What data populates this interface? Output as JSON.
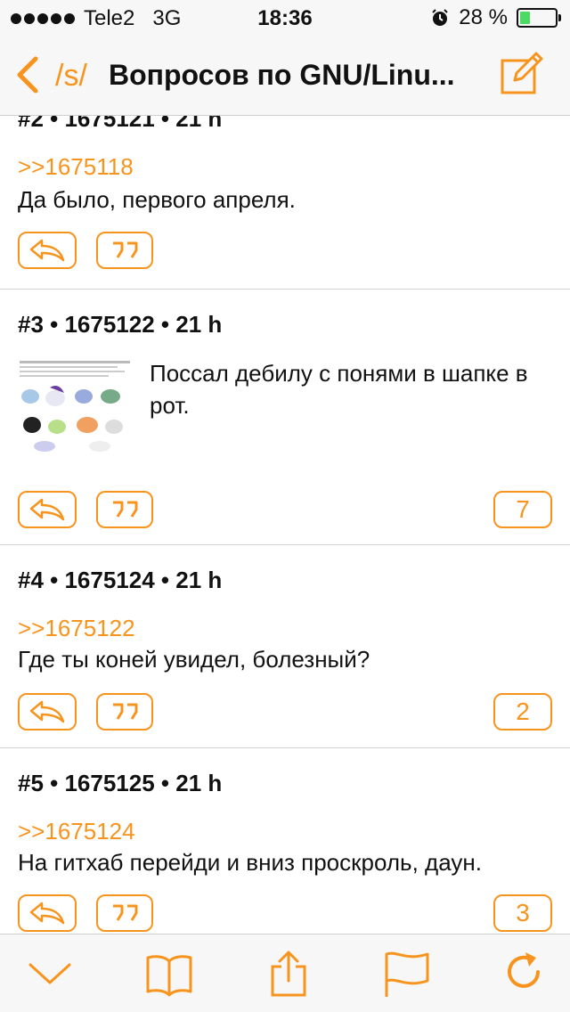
{
  "status": {
    "carrier": "Tele2",
    "network": "3G",
    "time": "18:36",
    "battery": "28 %",
    "battery_level": 0.28
  },
  "nav": {
    "board": "/s/",
    "title": "Вопросов по GNU/Linu..."
  },
  "posts": [
    {
      "header": "#2 • 1675121 • 21 h",
      "reply_to": ">>1675118",
      "text": "Да было, первого апреля.",
      "replies_count": ""
    },
    {
      "header": "#3 • 1675122 • 21 h",
      "reply_to": "",
      "text": "Поссал дебилу с понями в шапке в рот.",
      "replies_count": "7"
    },
    {
      "header": "#4 • 1675124 • 21 h",
      "reply_to": ">>1675122",
      "text": "Где ты коней увидел, болезный?",
      "replies_count": "2"
    },
    {
      "header": "#5 • 1675125 • 21 h",
      "reply_to": ">>1675124",
      "text": "На гитхаб перейди и вниз проскроль, даун.",
      "replies_count": "3"
    }
  ],
  "colors": {
    "accent": "#f7941d",
    "battery": "#4cd964"
  },
  "toolbar": {
    "icons": [
      "chevron-down-icon",
      "book-icon",
      "share-icon",
      "flag-icon",
      "refresh-icon"
    ]
  }
}
